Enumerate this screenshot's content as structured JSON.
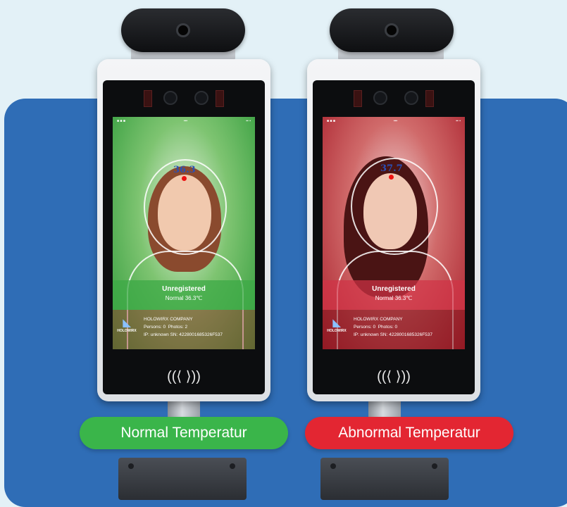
{
  "colors": {
    "background": "#e3f1f7",
    "panel": "#2f6db6",
    "normal_pill": "#3ab54a",
    "abnormal_pill": "#e32632"
  },
  "left_device": {
    "temperature": "36.3",
    "status": "Unregistered",
    "status_detail": "Normal 36.3℃",
    "company": "HOLOWIRX COMPANY",
    "persons": "Persons: 0",
    "photos": "Photos: 2",
    "ip_line": "IP: unknown SN: 4228001685326F537",
    "logo_text": "HOLOWIRX",
    "nfc_glyph": "((⟨ ⟩))"
  },
  "right_device": {
    "temperature": "37.7",
    "status": "Unregistered",
    "status_detail": "Normal 36.3℃",
    "company": "HOLOWIRX COMPANY",
    "persons": "Persons: 0",
    "photos": "Photos: 0",
    "ip_line": "IP: unknown SN: 4228001685326F537",
    "logo_text": "HOLOWIRX",
    "nfc_glyph": "((⟨ ⟩))"
  },
  "labels": {
    "normal": "Normal Temperatur",
    "abnormal": "Abnormal Temperatur"
  }
}
